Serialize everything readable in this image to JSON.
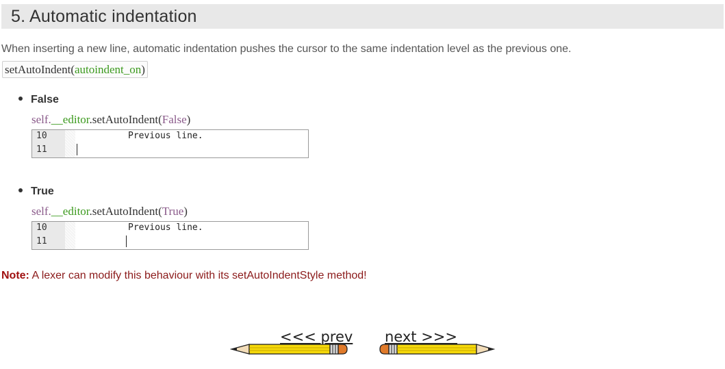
{
  "section": {
    "title": "5. Automatic indentation"
  },
  "intro": "When inserting a new line, automatic indentation pushes the cursor to the same indentation level as the previous one.",
  "signature": {
    "method": "setAutoIndent(",
    "param": "autoindent_on",
    "close": ")"
  },
  "examples": [
    {
      "label": "False",
      "call_self": "self.",
      "call_editor": "__editor",
      "call_method": ".setAutoIndent(",
      "call_arg": "False",
      "call_close": ")",
      "lines": [
        {
          "number": "10",
          "text": "Previous line."
        },
        {
          "number": "11",
          "text": ""
        }
      ]
    },
    {
      "label": "True",
      "call_self": "self.",
      "call_editor": "__editor",
      "call_method": ".setAutoIndent(",
      "call_arg": "True",
      "call_close": ")",
      "lines": [
        {
          "number": "10",
          "text": "Previous line."
        },
        {
          "number": "11",
          "text": ""
        }
      ]
    }
  ],
  "note": {
    "label": "Note:",
    "text": " A lexer can modify this behaviour with its setAutoIndentStyle method!"
  },
  "nav": {
    "prev": "<<< prev",
    "next": "next >>>"
  },
  "colors": {
    "pencil_body": "#f5d90a",
    "pencil_eraser": "#e07a2a",
    "note": "#8b1a1a",
    "keyword_green": "#3c9a1e",
    "self_purple": "#8a5a8a"
  }
}
